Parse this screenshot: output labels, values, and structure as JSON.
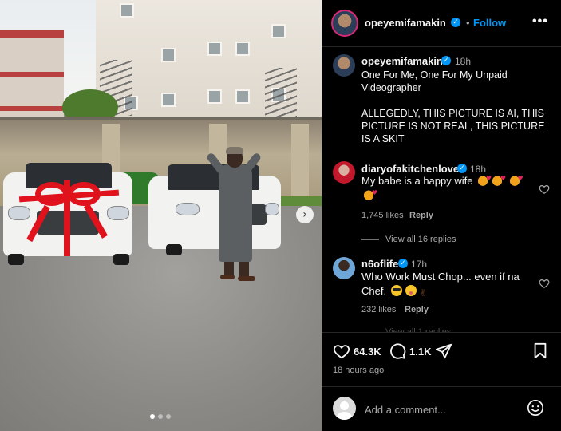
{
  "post": {
    "author": "opeyemifamakin",
    "follow_label": "Follow",
    "separator": "•",
    "more_label": "•••",
    "caption_time": "18h",
    "caption_line1": "One For Me, One For My Unpaid Videographer",
    "caption_line2": "ALLEGEDLY, THIS PICTURE IS AI, THIS PICTURE IS NOT REAL, THIS PICTURE IS A SKIT",
    "likes_count": "64.3K",
    "comments_count": "1.1K",
    "posted_ago": "18 hours ago"
  },
  "photo": {
    "next_label": "›",
    "carousel_dots": 3,
    "active_dot": 1
  },
  "comments": [
    {
      "user": "diaryofakitchenlover",
      "time": "18h",
      "text": "My babe is a happy wife",
      "likes": "1,745 likes",
      "reply_label": "Reply",
      "view_replies": "View all 16 replies"
    },
    {
      "user": "n6oflife",
      "time": "17h",
      "text": "Who Work Must Chop... even if na Chef.",
      "likes": "232 likes",
      "reply_label": "Reply",
      "view_replies": "View all 1 replies"
    }
  ],
  "composer": {
    "placeholder": "Add a comment..."
  },
  "icons": {
    "verified": "verified-badge-icon",
    "like": "heart-icon",
    "comment": "comment-bubble-icon",
    "share": "paper-plane-icon",
    "save": "bookmark-icon",
    "emoji": "smiley-icon",
    "more": "more-options-icon"
  },
  "colors": {
    "background": "#000000",
    "text": "#f5f5f5",
    "muted": "#a8a8a8",
    "accent": "#0095f6",
    "divider": "#262626"
  }
}
